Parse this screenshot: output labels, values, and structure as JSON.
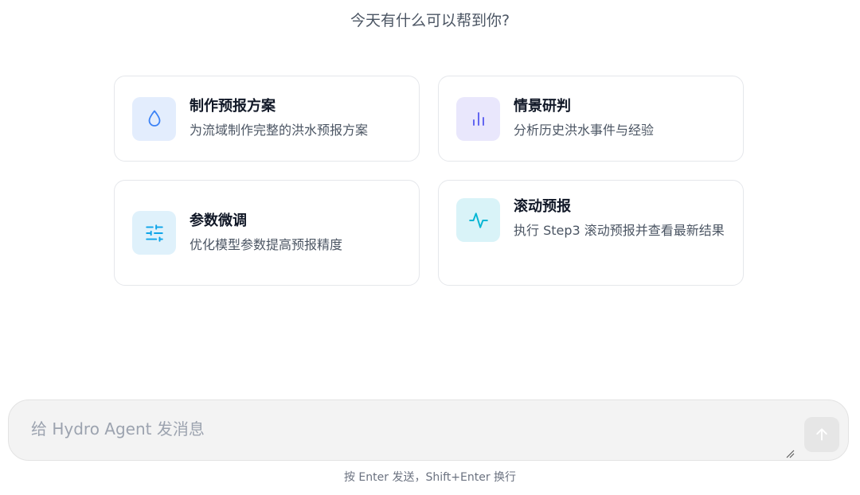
{
  "greeting": "今天有什么可以帮到你?",
  "cards": [
    {
      "title": "制作预报方案",
      "description": "为流域制作完整的洪水预报方案",
      "icon": "water-drop-icon",
      "icon_color": "#3b82f6",
      "icon_bg": "#e3edfd"
    },
    {
      "title": "情景研判",
      "description": "分析历史洪水事件与经验",
      "icon": "bar-chart-icon",
      "icon_color": "#6366f1",
      "icon_bg": "#e9e7fc"
    },
    {
      "title": "参数微调",
      "description": "优化模型参数提高预报精度",
      "icon": "sliders-icon",
      "icon_color": "#0ea5e9",
      "icon_bg": "#dff1fb"
    },
    {
      "title": "滚动预报",
      "description": "执行 Step3 滚动预报并查看最新结果",
      "icon": "activity-pulse-icon",
      "icon_color": "#06b6d4",
      "icon_bg": "#d9f3f8"
    }
  ],
  "composer": {
    "value": "",
    "placeholder": "给 Hydro Agent 发消息",
    "send_icon": "arrow-up-icon"
  },
  "hint": "按 Enter 发送，Shift+Enter 换行"
}
